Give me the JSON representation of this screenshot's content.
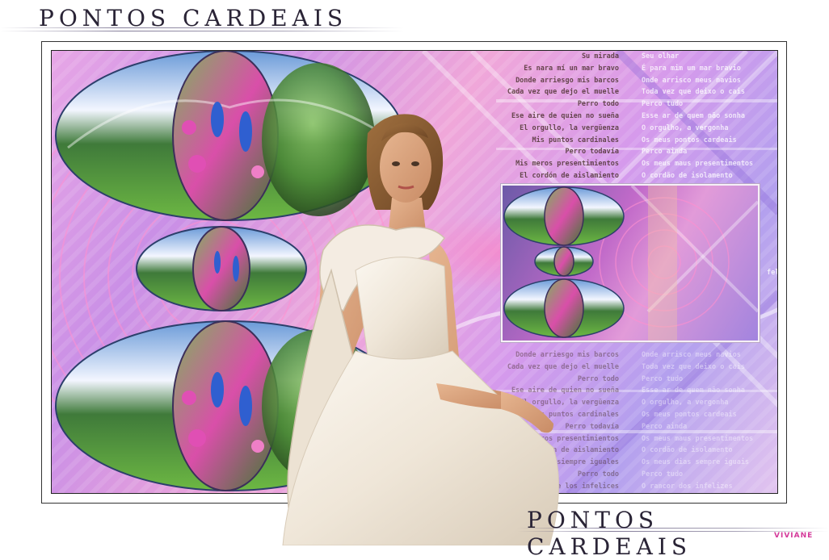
{
  "title_top": "PONTOS CARDEAIS",
  "title_bottom": "PONTOS CARDEAIS",
  "signature": "VIVIANE",
  "poem_spanish": [
    "Su mirada",
    "Es nara mí un mar bravo",
    "Donde arriesgo mis barcos",
    "Cada vez que dejo el muelle",
    "Perro todo",
    "Ese aire de quien no sueña",
    "El orgullo, la vergüenza",
    "Mis puntos cardinales",
    "Perro todavía",
    "Mis meros presentimientos",
    "El cordón de aislamiento"
  ],
  "poem_portuguese": [
    "Seu olhar",
    "É para mim um mar bravio",
    "Onde arrisco meus navios",
    "Toda vez que deixo o cais",
    "Perco tudo",
    "Esse ar de quem não sonha",
    "O orgulho, a vergonha",
    "Os meus pontos cardeais",
    "Perco ainda",
    "Os meus maus presentimentos",
    "O cordão de isolamento"
  ],
  "poem_spanish_lower": [
    "Donde arriesgo mis barcos",
    "Cada vez que dejo el muelle",
    "Perro todo",
    "Ese aire de quien no sueña",
    "El orgullo, la vergüenza",
    "Mis puntos cardinales",
    "Perro todavía",
    "Mis meros presentimientos",
    "El cordón de aislamiento",
    "Mis días siempre iguales",
    "Perro todo",
    "Rencor de los infelices"
  ],
  "poem_portuguese_lower": [
    "Onde arrisco meus navios",
    "Toda vez que deixo o cais",
    "Perco tudo",
    "Esse ar de quem não sonha",
    "O orgulho, a vergonha",
    "Os meus pontos cardeais",
    "Perco ainda",
    "Os meus maus presentimentos",
    "O cordão de isolamento",
    "Os meus dias sempre iguais",
    "Perco tudo",
    "O rancor dos infelizes"
  ],
  "felis_text": "feliz",
  "colors": {
    "background": "#ffffff",
    "title": "#2a2436",
    "signature": "#d43a9a",
    "dress": "#f2ebe0",
    "skin": "#d9a27e",
    "hair": "#8a5a34",
    "bird_blue": "#2f5fd0"
  }
}
